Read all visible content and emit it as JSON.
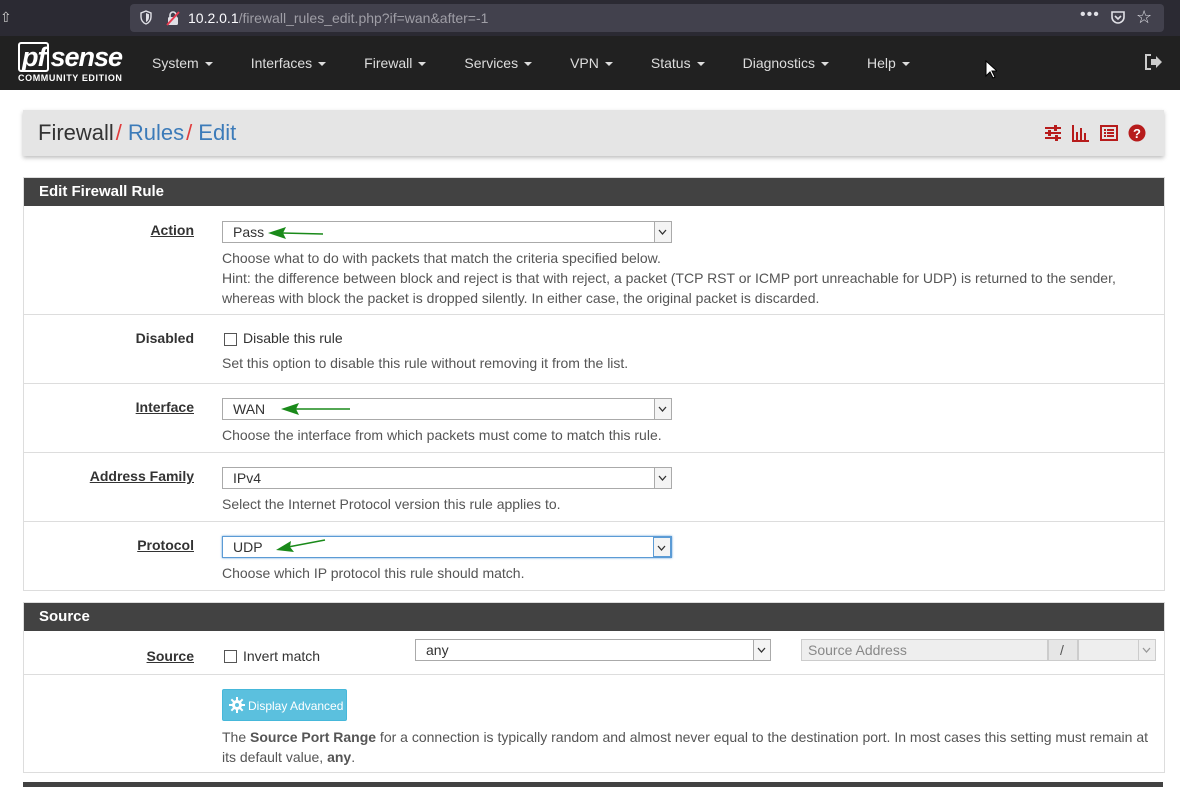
{
  "browser": {
    "url_host": "10.2.0.1",
    "url_path": "/firewall_rules_edit.php?if=wan&after=-1",
    "menu_dots": "•••"
  },
  "navbar": {
    "logo_main": "sense",
    "logo_pf": "pf",
    "logo_sub": "COMMUNITY EDITION",
    "items": [
      "System",
      "Interfaces",
      "Firewall",
      "Services",
      "VPN",
      "Status",
      "Diagnostics",
      "Help"
    ]
  },
  "breadcrumb": {
    "root": "Firewall",
    "sep": "/",
    "level2": "Rules",
    "level3": "Edit"
  },
  "edit_panel": {
    "title": "Edit Firewall Rule",
    "action": {
      "label": "Action",
      "value": "Pass",
      "help1": "Choose what to do with packets that match the criteria specified below.",
      "help2": "Hint: the difference between block and reject is that with reject, a packet (TCP RST or ICMP port unreachable for UDP) is returned to the sender,",
      "help3": "whereas with block the packet is dropped silently. In either case, the original packet is discarded."
    },
    "disabled": {
      "label": "Disabled",
      "checkbox_label": "Disable this rule",
      "help": "Set this option to disable this rule without removing it from the list."
    },
    "interface": {
      "label": "Interface",
      "value": "WAN",
      "help": "Choose the interface from which packets must come to match this rule."
    },
    "address_family": {
      "label": "Address Family",
      "value": "IPv4",
      "help": "Select the Internet Protocol version this rule applies to."
    },
    "protocol": {
      "label": "Protocol",
      "value": "UDP",
      "help": "Choose which IP protocol this rule should match."
    }
  },
  "source_panel": {
    "title": "Source",
    "label": "Source",
    "invert_label": "Invert match",
    "source_value": "any",
    "address_placeholder": "Source Address",
    "slash": "/",
    "advanced_button": "Display Advanced",
    "help_pre": "The ",
    "help_bold": "Source Port Range",
    "help_mid": " for a connection is typically random and almost never equal to the destination port. In most cases this setting must remain at",
    "help_line2_pre": "its default value, ",
    "help_line2_bold": "any",
    "help_line2_post": "."
  },
  "colors": {
    "navbar_bg": "#212121",
    "panel_heading_bg": "#424242",
    "breadcrumb_sep": "#e03c3c",
    "link": "#3c7bb9",
    "icon_red": "#b71c1c",
    "button_info": "#5bc0de",
    "annotation_arrow": "#1a8a1a"
  }
}
